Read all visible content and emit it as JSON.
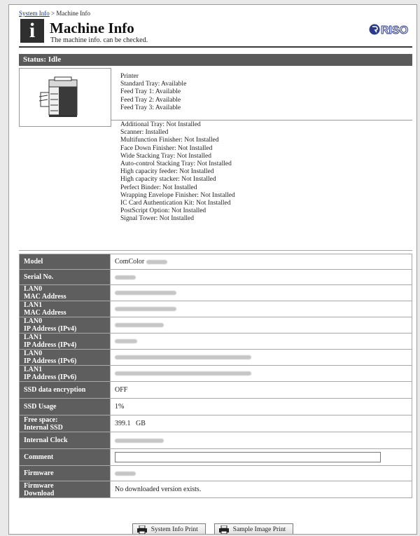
{
  "breadcrumb": {
    "root": "System Info",
    "separator": " > ",
    "current": "Machine Info"
  },
  "header": {
    "title": "Machine Info",
    "subtitle": "The machine info. can be checked.",
    "logo_text": "RISO"
  },
  "status": {
    "label": "Status: Idle"
  },
  "options_top": [
    "Printer",
    "Standard Tray: Available",
    "Feed Tray 1: Available",
    "Feed Tray 2: Available",
    "Feed Tray 3: Available"
  ],
  "options_bottom": [
    "Additional Tray: Not Installed",
    "Scanner: Installed",
    "Multifunction Finisher: Not Installed",
    "Face Down Finisher: Not Installed",
    "Wide Stacking Tray: Not Installed",
    "Auto-control Stacking Tray: Not Installed",
    "High capacity feeder: Not Installed",
    "High capacity stacker: Not Installed",
    "Perfect Binder: Not Installed",
    "Wrapping Envelope Finisher: Not Installed",
    "IC Card Authentication Kit: Not Installed",
    "PostScript Option: Not Installed",
    "Signal Tower: Not Installed"
  ],
  "rows": [
    {
      "key": "Model",
      "value": "ComColor"
    },
    {
      "key": "Serial No.",
      "value": ""
    },
    {
      "key": "LAN0\nMAC Address",
      "value": ""
    },
    {
      "key": "LAN1\nMAC Address",
      "value": ""
    },
    {
      "key": "LAN0\nIP Address (IPv4)",
      "value": ""
    },
    {
      "key": "LAN1\nIP Address (IPv4)",
      "value": ""
    },
    {
      "key": "LAN0\nIP Address (IPv6)",
      "value": ""
    },
    {
      "key": "LAN1\nIP Address (IPv6)",
      "value": ""
    },
    {
      "key": "SSD data encryption",
      "value": "OFF"
    },
    {
      "key": "SSD Usage",
      "value": "1%"
    },
    {
      "key": "Free space:\nInternal SSD",
      "value": "399.1   GB"
    },
    {
      "key": "Internal Clock",
      "value": ""
    },
    {
      "key": "Comment",
      "value": ""
    },
    {
      "key": "Firmware",
      "value": ""
    },
    {
      "key": "Firmware\nDownload",
      "value": "No downloaded version exists."
    }
  ],
  "buttons": {
    "system_info_print": "System Info Print",
    "sample_image_print": "Sample Image Print"
  },
  "colors": {
    "header_dark": "#5a5a5a",
    "link": "#1b2f8a",
    "logo": "#2c3a8c"
  }
}
